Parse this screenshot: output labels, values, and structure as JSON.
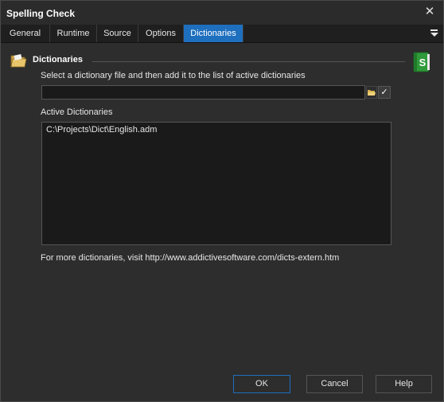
{
  "window": {
    "title": "Spelling Check",
    "close_glyph": "✕"
  },
  "tabs": [
    {
      "label": "General"
    },
    {
      "label": "Runtime"
    },
    {
      "label": "Source"
    },
    {
      "label": "Options"
    },
    {
      "label": "Dictionaries",
      "active": true
    }
  ],
  "section": {
    "title": "Dictionaries",
    "icon": "folder-icon",
    "corner_icon": "book-icon"
  },
  "dictionary_file": {
    "prompt": "Select a dictionary file and then add it to the list of active dictionaries",
    "value": "",
    "placeholder": "",
    "browse_icon": "folder-open-icon",
    "add_glyph": "✓"
  },
  "active_dictionaries": {
    "label": "Active Dictionaries",
    "items": [
      "C:\\Projects\\Dict\\English.adm"
    ]
  },
  "footer_note": "For more dictionaries, visit http://www.addictivesoftware.com/dicts-extern.htm",
  "buttons": {
    "ok": "OK",
    "cancel": "Cancel",
    "help": "Help"
  },
  "colors": {
    "accent": "#1f6fbf",
    "background": "#2d2d2d",
    "field_bg": "#1a1a1a"
  }
}
